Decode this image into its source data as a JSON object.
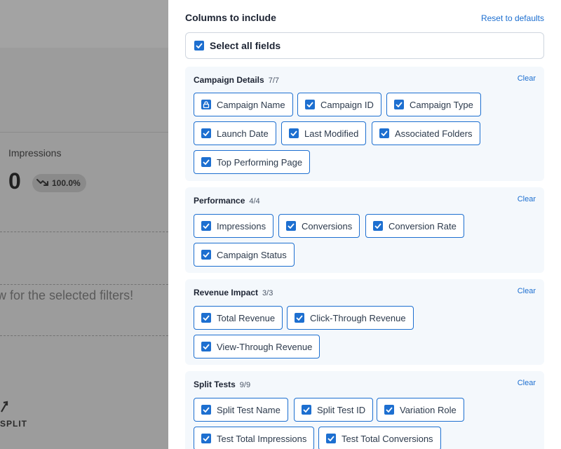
{
  "background": {
    "impressions_label": "Impressions",
    "impressions_value": "0",
    "change_pct": "100.0%",
    "empty_message": "w for the selected filters!",
    "split_label": "SPLIT"
  },
  "drawer": {
    "title": "Columns to include",
    "reset_label": "Reset to defaults",
    "select_all_label": "Select all fields",
    "clear_label": "Clear",
    "accent": "#1d6fd0"
  },
  "sections": [
    {
      "title": "Campaign Details",
      "count": "7/7",
      "items": [
        "Campaign Name",
        "Campaign ID",
        "Campaign Type",
        "Launch Date",
        "Last Modified",
        "Associated Folders",
        "Top Performing Page"
      ]
    },
    {
      "title": "Performance",
      "count": "4/4",
      "items": [
        "Impressions",
        "Conversions",
        "Conversion Rate",
        "Campaign Status"
      ]
    },
    {
      "title": "Revenue Impact",
      "count": "3/3",
      "items": [
        "Total Revenue",
        "Click-Through Revenue",
        "View-Through Revenue"
      ]
    },
    {
      "title": "Split Tests",
      "count": "9/9",
      "items": [
        "Split Test Name",
        "Split Test ID",
        "Variation Role",
        "Test Total Impressions",
        "Test Total Conversions"
      ]
    }
  ]
}
